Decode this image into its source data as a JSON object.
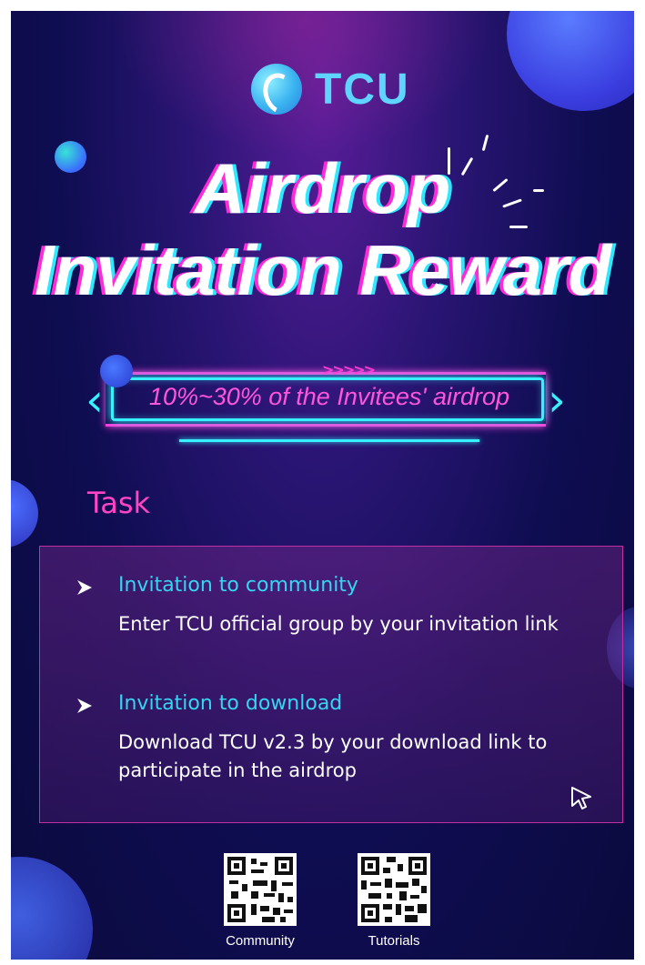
{
  "brand": {
    "name": "TCU",
    "logo_icon": "yin-yang-logo-icon"
  },
  "headline": {
    "line1": "Airdrop",
    "line2": "Invitation Reward"
  },
  "banner": {
    "arrows": ">>>>>",
    "text": "10%~30% of the Invitees' airdrop"
  },
  "task": {
    "title": "Task",
    "items": [
      {
        "title": "Invitation to community",
        "description": "Enter TCU official group by your invitation link"
      },
      {
        "title": "Invitation to download",
        "description": "Download TCU v2.3 by your download link to participate in the airdrop"
      }
    ]
  },
  "qr_codes": [
    {
      "label": "Community"
    },
    {
      "label": "Tutorials"
    }
  ],
  "colors": {
    "cyan": "#38f1ff",
    "magenta": "#ff3bd8",
    "task_title": "#ff44c6",
    "item_title": "#34d6f0"
  }
}
